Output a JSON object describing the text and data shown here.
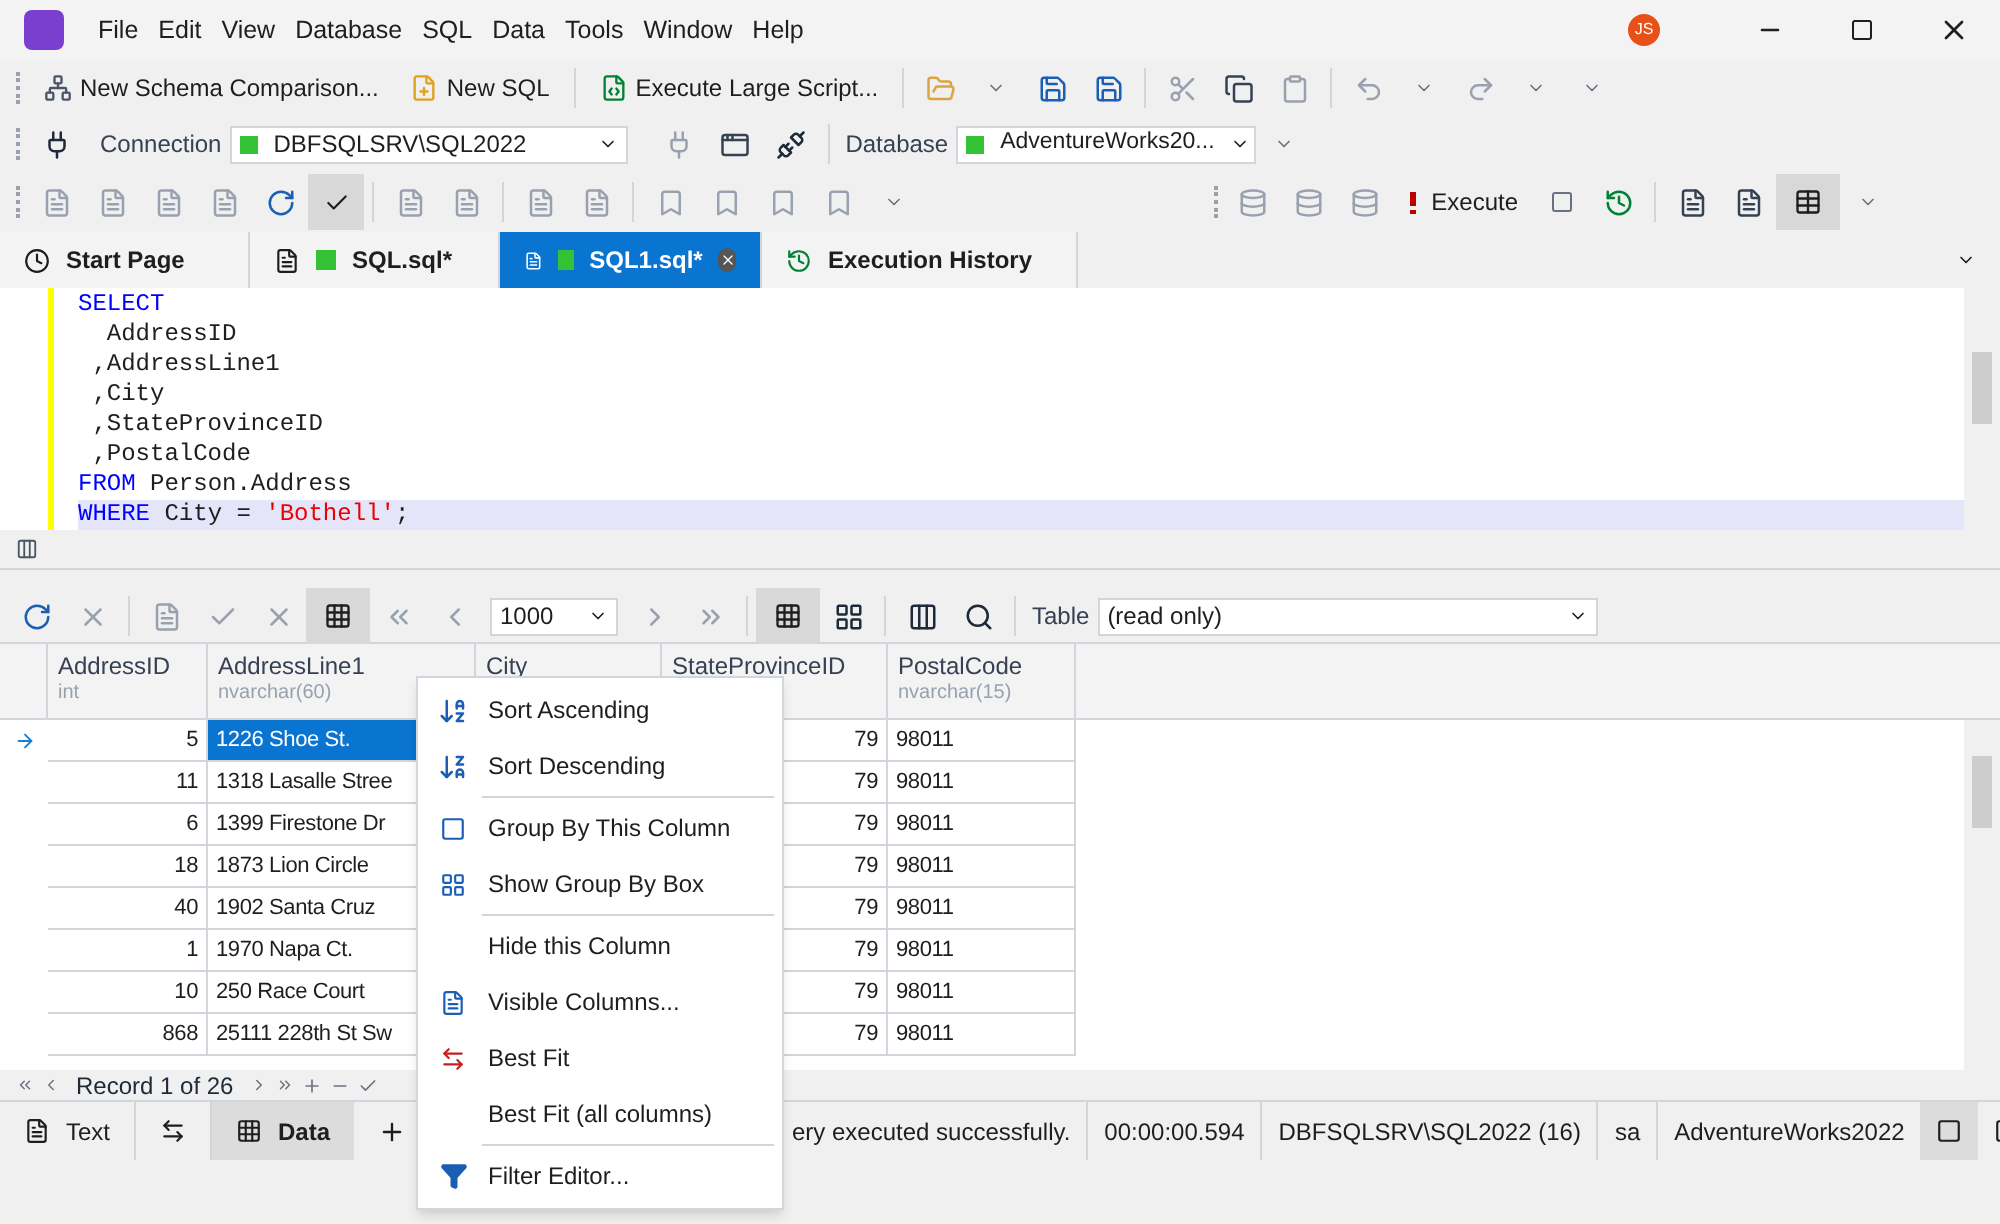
{
  "menu_bar": {
    "items": [
      "File",
      "Edit",
      "View",
      "Database",
      "SQL",
      "Data",
      "Tools",
      "Window",
      "Help"
    ],
    "avatar": "JS"
  },
  "toolbar": {
    "buttons": [
      "New Schema Comparison...",
      "New SQL",
      "Execute Large Script..."
    ]
  },
  "connection_bar": {
    "connection_label": "Connection",
    "connection": {
      "value": "DBFSQLSRV\\SQL2022",
      "color": "#33c233"
    },
    "database_label": "Database",
    "database": {
      "value": "AdventureWorks20...",
      "color": "#33c233"
    }
  },
  "sql_toolbar": {
    "execute": "Execute"
  },
  "tabs": [
    {
      "label": "Start Page",
      "selected": false,
      "kind": "start"
    },
    {
      "label": "SQL.sql*",
      "selected": false,
      "kind": "sql",
      "color": "#33c233"
    },
    {
      "label": "SQL1.sql*",
      "selected": true,
      "kind": "sql",
      "color": "#33c233"
    },
    {
      "label": "Execution History",
      "selected": false,
      "kind": "history"
    }
  ],
  "editor": {
    "lines": [
      {
        "highlighted": false,
        "tokens": [
          {
            "kind": "keyword",
            "text": "SELECT"
          }
        ]
      },
      {
        "highlighted": false,
        "tokens": [
          {
            "kind": "text",
            "text": "  AddressID"
          }
        ]
      },
      {
        "highlighted": false,
        "tokens": [
          {
            "kind": "text",
            "text": " ,AddressLine1"
          }
        ]
      },
      {
        "highlighted": false,
        "tokens": [
          {
            "kind": "text",
            "text": " ,City"
          }
        ]
      },
      {
        "highlighted": false,
        "tokens": [
          {
            "kind": "text",
            "text": " ,StateProvinceID"
          }
        ]
      },
      {
        "highlighted": false,
        "tokens": [
          {
            "kind": "text",
            "text": " ,PostalCode"
          }
        ]
      },
      {
        "highlighted": false,
        "tokens": [
          {
            "kind": "keyword",
            "text": "FROM"
          },
          {
            "kind": "text",
            "text": " Person.Address"
          }
        ]
      },
      {
        "highlighted": true,
        "tokens": [
          {
            "kind": "keyword",
            "text": "WHERE"
          },
          {
            "kind": "text",
            "text": " City = "
          },
          {
            "kind": "string",
            "text": "'Bothell'"
          },
          {
            "kind": "text",
            "text": ";"
          }
        ]
      }
    ]
  },
  "grid_toolbar": {
    "page_size": "1000",
    "table_label": "Table",
    "table": "(read only)"
  },
  "grid": {
    "columns": [
      {
        "name": "AddressID",
        "type": "int",
        "kind": "number"
      },
      {
        "name": "AddressLine1",
        "type": "nvarchar(60)",
        "kind": "text"
      },
      {
        "name": "City",
        "kind": "text"
      },
      {
        "name": "StateProvinceID",
        "kind": "number"
      },
      {
        "name": "PostalCode",
        "type": "nvarchar(15)",
        "kind": "text"
      }
    ],
    "rows": [
      {
        "current": true,
        "cells": [
          "5",
          "1226 Shoe St.",
          null,
          "79",
          "98011"
        ]
      },
      {
        "current": false,
        "cells": [
          "11",
          "1318 Lasalle Stree",
          null,
          "79",
          "98011"
        ]
      },
      {
        "current": false,
        "cells": [
          "6",
          "1399 Firestone Dr",
          null,
          "79",
          "98011"
        ]
      },
      {
        "current": false,
        "cells": [
          "18",
          "1873 Lion Circle",
          null,
          "79",
          "98011"
        ]
      },
      {
        "current": false,
        "cells": [
          "40",
          "1902 Santa Cruz",
          null,
          "79",
          "98011"
        ]
      },
      {
        "current": false,
        "cells": [
          "1",
          "1970 Napa Ct.",
          null,
          "79",
          "98011"
        ]
      },
      {
        "current": false,
        "cells": [
          "10",
          "250 Race Court",
          null,
          "79",
          "98011"
        ]
      },
      {
        "current": false,
        "cells": [
          "868",
          "25111 228th St Sw",
          null,
          "79",
          "98011"
        ]
      }
    ],
    "record": "Record 1 of 26"
  },
  "bottom_tabs": [
    {
      "label": "Text",
      "selected": false,
      "kind": "text"
    },
    {
      "label": "Data",
      "selected": true,
      "kind": "data"
    }
  ],
  "status_bar": {
    "message": "ery executed successfully.",
    "time": "00:00:00.594",
    "server": "DBFSQLSRV\\SQL2022 (16)",
    "user": "sa",
    "database": "AdventureWorks2022"
  },
  "context_menu": [
    {
      "label": "Sort Ascending",
      "kind": "sort-asc",
      "separator_after": false
    },
    {
      "label": "Sort Descending",
      "kind": "sort-desc",
      "separator_after": true
    },
    {
      "label": "Group By This Column",
      "kind": "group",
      "separator_after": false
    },
    {
      "label": "Show Group By Box",
      "kind": "group-box",
      "separator_after": true
    },
    {
      "label": "Hide this Column",
      "kind": "none",
      "separator_after": false
    },
    {
      "label": "Visible Columns...",
      "kind": "columns",
      "separator_after": false
    },
    {
      "label": "Best Fit",
      "kind": "best-fit",
      "separator_after": false
    },
    {
      "label": "Best Fit (all columns)",
      "kind": "none",
      "separator_after": true
    },
    {
      "label": "Filter Editor...",
      "kind": "filter",
      "separator_after": false
    }
  ]
}
